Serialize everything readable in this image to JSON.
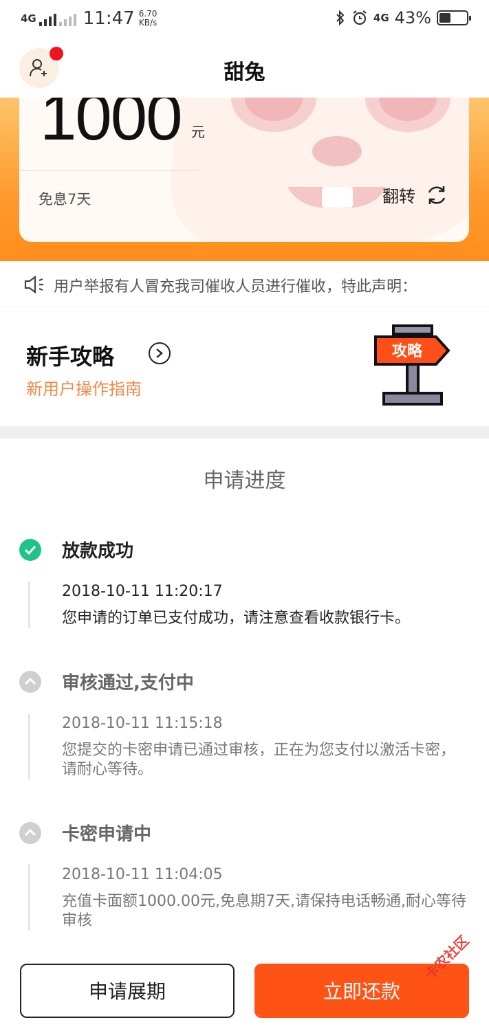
{
  "status_bar": {
    "network": "4G",
    "time": "11:47",
    "speed_value": "6.70",
    "speed_unit": "KB/s",
    "network_right": "4G",
    "battery": "43%",
    "battery_level": 0.43
  },
  "header": {
    "title": "甜兔"
  },
  "card": {
    "amount": "1000",
    "unit": "元",
    "term": "免息7天",
    "flip_label": "翻转"
  },
  "notice": {
    "text": "用户举报有人冒充我司催收人员进行催收，特此声明："
  },
  "guide": {
    "title": "新手攻略",
    "subtitle": "新用户操作指南",
    "sign_text": "攻略"
  },
  "progress": {
    "title": "申请进度",
    "steps": [
      {
        "title": "放款成功",
        "time": "2018-10-11 11:20:17",
        "desc": "您申请的订单已支付成功，请注意查看收款银行卡。",
        "state": "done"
      },
      {
        "title": "审核通过,支付中",
        "time": "2018-10-11 11:15:18",
        "desc": "您提交的卡密申请已通过审核，正在为您支付以激活卡密，请耐心等待。",
        "state": "past"
      },
      {
        "title": "卡密申请中",
        "time": "2018-10-11 11:04:05",
        "desc": "充值卡面额1000.00元,免息期7天,请保持电话畅通,耐心等待审核",
        "state": "past"
      }
    ]
  },
  "actions": {
    "extend_label": "申请展期",
    "repay_label": "立即还款"
  },
  "watermark": "卡农社区",
  "colors": {
    "accent_orange": "#ff5316",
    "success_green": "#1ec28b",
    "card_gradient": "#ff9a2e",
    "guide_subtitle": "#f28a4a"
  }
}
